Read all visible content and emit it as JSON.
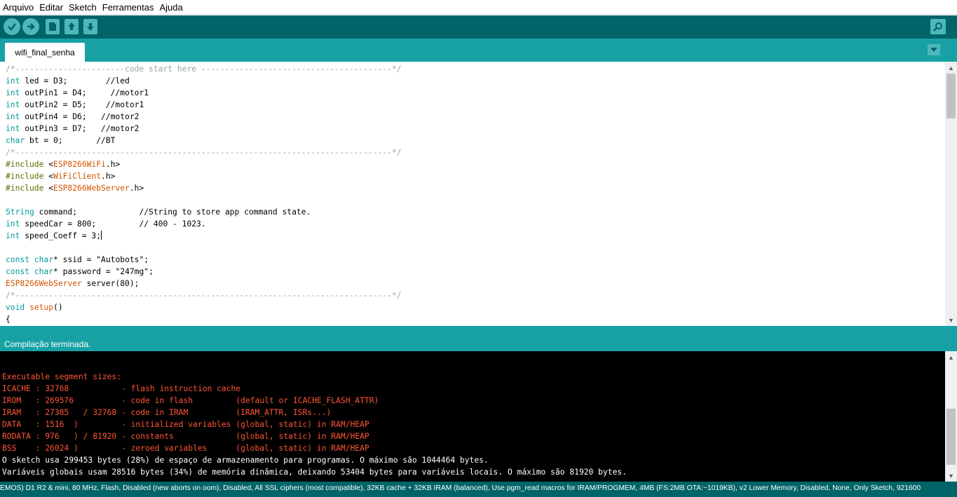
{
  "menu": [
    "Arquivo",
    "Editar",
    "Sketch",
    "Ferramentas",
    "Ajuda"
  ],
  "toolbar": {
    "buttons": [
      "verify-icon",
      "upload-icon",
      "new-icon",
      "open-icon",
      "save-icon"
    ],
    "serial_monitor": "serial-monitor-icon"
  },
  "tab": {
    "name": "wifi_final_senha"
  },
  "code": [
    "/*-----------------------code start here ----------------------------------------*/",
    "int led = D3;        //led",
    "int outPin1 = D4;     //motor1",
    "int outPin2 = D5;    //motor1",
    "int outPin4 = D6;   //motor2",
    "int outPin3 = D7;   //motor2",
    "char bt = 0;       //BT",
    "/*-------------------------------------------------------------------------------*/",
    "#include <ESP8266WiFi.h>",
    "#include <WiFiClient.h>",
    "#include <ESP8266WebServer.h>",
    "",
    "String command;             //String to store app command state.",
    "int speedCar = 800;         // 400 - 1023.",
    "int speed_Coeff = 3;",
    "",
    "const char* ssid = \"Autobots\";",
    "const char* password = \"247mg\";",
    "ESP8266WebServer server(80);",
    "/*-------------------------------------------------------------------------------*/",
    "void setup()",
    "{"
  ],
  "status": {
    "message": "Compilação terminada."
  },
  "console": [
    "",
    "Executable segment sizes:",
    "ICACHE : 32768           - flash instruction cache",
    "IROM   : 269576          - code in flash         (default or ICACHE_FLASH_ATTR)",
    "IRAM   : 27385   / 32768 - code in IRAM          (IRAM_ATTR, ISRs...)",
    "DATA   : 1516  )         - initialized variables (global, static) in RAM/HEAP",
    "RODATA : 976   ) / 81920 - constants             (global, static) in RAM/HEAP",
    "BSS    : 26024 )         - zeroed variables      (global, static) in RAM/HEAP",
    "O sketch usa 299453 bytes (28%) de espaço de armazenamento para programas. O máximo são 1044464 bytes.",
    "Variáveis globais usam 28516 bytes (34%) de memória dinâmica, deixando 53404 bytes para variáveis locais. O máximo são 81920 bytes."
  ],
  "footer": {
    "board": "EMOS) D1 R2 & mini, 80 MHz, Flash, Disabled (new aborts on oom), Disabled, All SSL ciphers (most compatible), 32KB cache + 32KB IRAM (balanced), Use pgm_read macros for IRAM/PROGMEM, 4MB (FS:2MB OTA:~1019KB), v2 Lower Memory, Disabled, None, Only Sketch, 921600"
  },
  "colors": {
    "toolbar": "#006468",
    "tabstrip": "#17a1a5",
    "console_error": "#ff5533",
    "type_keyword": "#00979c",
    "library": "#d35400",
    "comment": "#95a5a6"
  }
}
